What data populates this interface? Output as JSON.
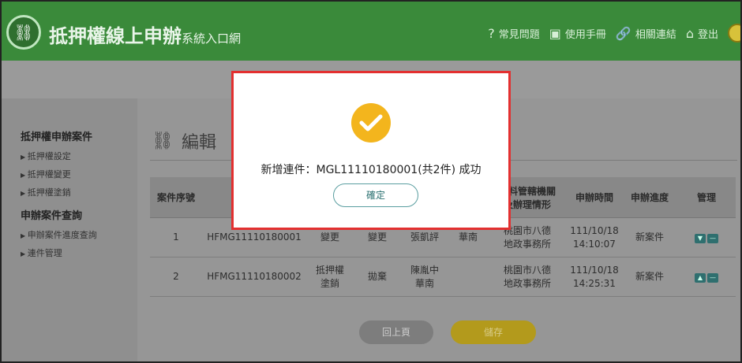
{
  "header": {
    "title": "抵押權線上申辦",
    "subtitle": "系統入口網",
    "nav": [
      {
        "label": "常見問題",
        "icon": "faq-icon"
      },
      {
        "label": "使用手冊",
        "icon": "manual-icon"
      },
      {
        "label": "相關連結",
        "icon": "link-icon"
      },
      {
        "label": "登出",
        "icon": "logout-icon"
      }
    ]
  },
  "sidebar": {
    "section1": "抵押權申辦案件",
    "items1": [
      "抵押權設定",
      "抵押權變更",
      "抵押權塗銷"
    ],
    "section2": "申辦案件查詢",
    "items2": [
      "申辦案件進度查詢",
      "連件管理"
    ]
  },
  "main": {
    "page_title": "編輯",
    "columns": [
      "案件序號",
      "",
      "",
      "",
      "",
      "資料管轄機關\n及辦理情形",
      "申辦時間",
      "申辦進度",
      "管理"
    ],
    "rows": [
      {
        "seq": "1",
        "case_no": "HFMG11110180001",
        "c2": "變更",
        "c3": "變更",
        "c4": "張凱評",
        "c5": "華南",
        "office": "桃園市八德\n地政事務所",
        "time": "111/10/18\n14:10:07",
        "status": "新案件"
      },
      {
        "seq": "2",
        "case_no": "HFMG11110180002",
        "c2": "抵押權\n塗銷",
        "c3": "拋棄",
        "c4": "陳胤中\n華南",
        "c5": "",
        "office": "桃園市八德\n地政事務所",
        "time": "111/10/18\n14:25:31",
        "status": "新案件"
      }
    ],
    "back_label": "回上頁",
    "save_label": "儲存"
  },
  "modal": {
    "message": "新增連件：MGL11110180001(共2件) 成功",
    "confirm_label": "確定"
  },
  "colors": {
    "header_green": "#3a8a3a",
    "modal_border": "#e33030",
    "check_yellow": "#f3b51d",
    "save_gold": "#b39a1c"
  }
}
